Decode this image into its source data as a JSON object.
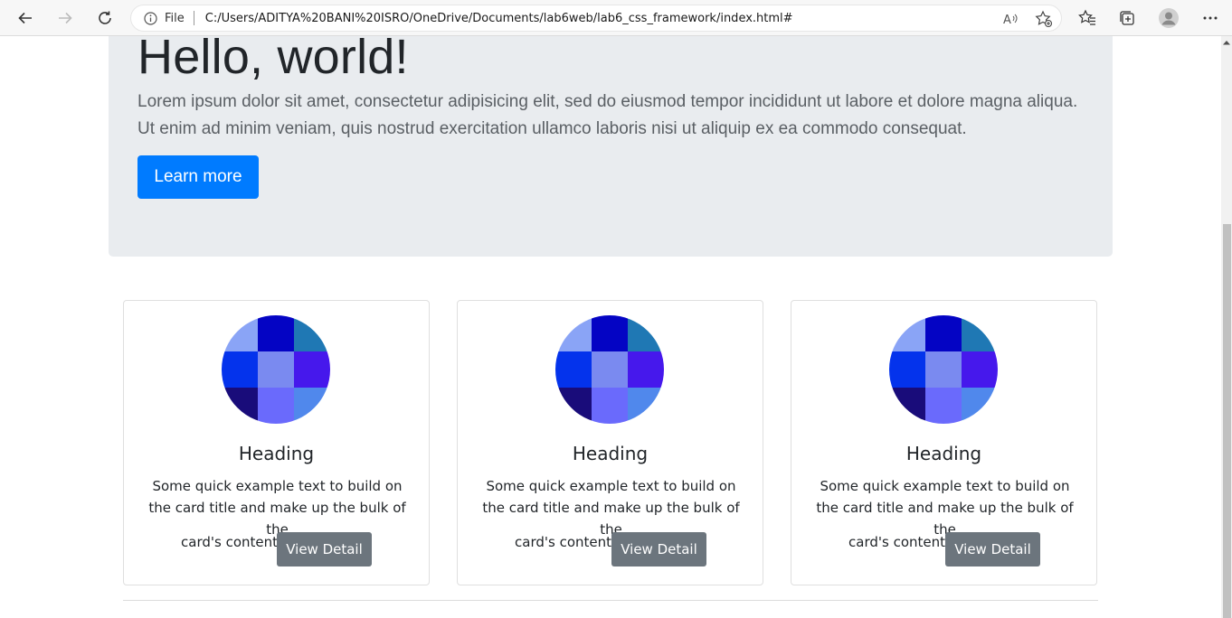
{
  "browser": {
    "address_file_label": "File",
    "url": "C:/Users/ADITYA%20BANI%20ISRO/OneDrive/Documents/lab6web/lab6_css_framework/index.html#",
    "read_aloud_label": "Aᴬ"
  },
  "jumbotron": {
    "title": "Hello, world!",
    "lead": "Lorem ipsum dolor sit amet, consectetur adipisicing elit, sed do eiusmod tempor incididunt ut labore et dolore magna aliqua. Ut enim ad minim veniam, quis nostrud exercitation ullamco laboris nisi ut aliquip ex ea commodo consequat.",
    "button_label": "Learn more"
  },
  "cards": [
    {
      "title": "Heading",
      "text": "Some quick example text to build on the card title and make up the bulk of the",
      "text_last": "card's content.",
      "button_label": "View Detail"
    },
    {
      "title": "Heading",
      "text": "Some quick example text to build on the card title and make up the bulk of the",
      "text_last": "card's content.",
      "button_label": "View Detail"
    },
    {
      "title": "Heading",
      "text": "Some quick example text to build on the card title and make up the bulk of the",
      "text_last": "card's content.",
      "button_label": "View Detail"
    }
  ],
  "colors": {
    "primary": "#007bff",
    "secondary": "#6c757d",
    "jumbotron_bg": "#e9ecef",
    "card_image_tiles": [
      "#8aa4f6",
      "#0404c4",
      "#1f78b4",
      "#0433ec",
      "#7a8af0",
      "#4618ec",
      "#190c7a",
      "#6a6afc",
      "#5088ec"
    ]
  }
}
